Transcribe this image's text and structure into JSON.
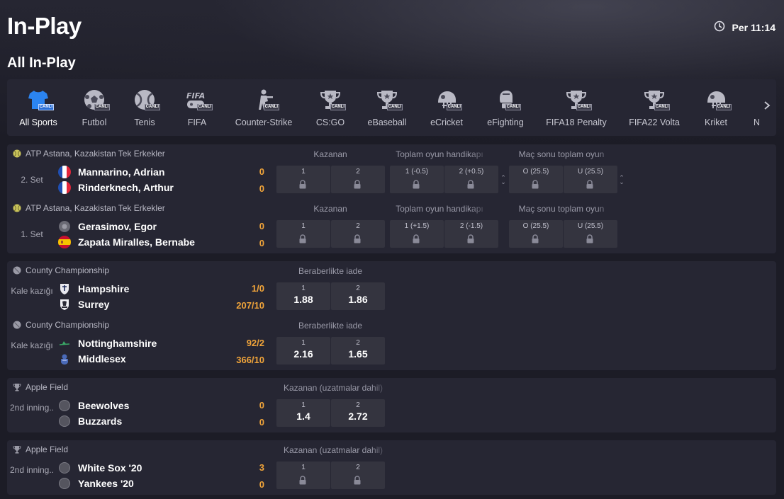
{
  "header": {
    "title": "In-Play",
    "time": "Per 11:14",
    "section_title": "All In-Play"
  },
  "sports_bar": {
    "badge": "CANLI",
    "items": [
      {
        "label": "All Sports",
        "icon": "shirt-icon",
        "active": true
      },
      {
        "label": "Futbol",
        "icon": "soccer-ball-icon",
        "active": false
      },
      {
        "label": "Tenis",
        "icon": "tennis-ball-icon",
        "active": false
      },
      {
        "label": "FIFA",
        "icon": "fifa-icon",
        "active": false
      },
      {
        "label": "Counter-Strike",
        "icon": "shooter-icon",
        "active": false
      },
      {
        "label": "CS:GO",
        "icon": "trophy-icon",
        "active": false
      },
      {
        "label": "eBaseball",
        "icon": "trophy-icon",
        "active": false
      },
      {
        "label": "eCricket",
        "icon": "helmet-icon",
        "active": false
      },
      {
        "label": "eFighting",
        "icon": "boxing-glove-icon",
        "active": false
      },
      {
        "label": "FIFA18 Penalty",
        "icon": "trophy-icon",
        "active": false
      },
      {
        "label": "FIFA22 Volta",
        "icon": "trophy-icon",
        "active": false
      },
      {
        "label": "Kriket",
        "icon": "helmet-icon",
        "active": false
      },
      {
        "label": "N",
        "icon": "",
        "active": false
      }
    ]
  },
  "colors": {
    "accent_blue": "#2b6fd6",
    "score_orange": "#f0a43a",
    "card_bg": "#262633",
    "odd_bg": "#34343f"
  },
  "events": [
    {
      "league": "ATP Astana, Kazakistan Tek Erkekler",
      "league_icon": "tennis-ball-icon",
      "status": "2. Set",
      "team1": {
        "name": "Mannarino, Adrian",
        "icon": "france-flag-icon",
        "score": "0"
      },
      "team2": {
        "name": "Rinderknech, Arthur",
        "icon": "france-flag-icon",
        "score": "0"
      },
      "markets": [
        {
          "label": "Kazanan",
          "odds": [
            {
              "label": "1",
              "value": ""
            },
            {
              "label": "2",
              "value": ""
            }
          ]
        },
        {
          "label": "Toplam oyun handikapı",
          "odds": [
            {
              "label": "1 (-0.5)",
              "value": ""
            },
            {
              "label": "2 (+0.5)",
              "value": ""
            }
          ]
        },
        {
          "label": "Maç sonu toplam oyun",
          "odds": [
            {
              "label": "O (25.5)",
              "value": ""
            },
            {
              "label": "U (25.5)",
              "value": ""
            }
          ]
        }
      ]
    },
    {
      "league": "ATP Astana, Kazakistan Tek Erkekler",
      "league_icon": "tennis-ball-icon",
      "status": "1. Set",
      "team1": {
        "name": "Gerasimov, Egor",
        "icon": "neutral-flag-icon",
        "score": "0"
      },
      "team2": {
        "name": "Zapata Miralles, Bernabe",
        "icon": "spain-flag-icon",
        "score": "0"
      },
      "markets": [
        {
          "label": "Kazanan",
          "odds": [
            {
              "label": "1",
              "value": ""
            },
            {
              "label": "2",
              "value": ""
            }
          ]
        },
        {
          "label": "Toplam oyun handikapı",
          "odds": [
            {
              "label": "1 (+1.5)",
              "value": ""
            },
            {
              "label": "2 (-1.5)",
              "value": ""
            }
          ]
        },
        {
          "label": "Maç sonu toplam oyun",
          "odds": [
            {
              "label": "O (25.5)",
              "value": ""
            },
            {
              "label": "U (25.5)",
              "value": ""
            }
          ]
        }
      ]
    },
    {
      "league": "County Championship",
      "league_icon": "cricket-ball-icon",
      "status": "Kale kazığı",
      "team1": {
        "name": "Hampshire",
        "icon": "hampshire-crest-icon",
        "score": "1/0"
      },
      "team2": {
        "name": "Surrey",
        "icon": "surrey-crest-icon",
        "score": "207/10"
      },
      "markets": [
        {
          "label": "Beraberlikte iade",
          "odds": [
            {
              "label": "1",
              "value": "1.88"
            },
            {
              "label": "2",
              "value": "1.86"
            }
          ]
        }
      ]
    },
    {
      "league": "County Championship",
      "league_icon": "cricket-ball-icon",
      "status": "Kale kazığı",
      "team1": {
        "name": "Nottinghamshire",
        "icon": "nottinghamshire-crest-icon",
        "score": "92/2"
      },
      "team2": {
        "name": "Middlesex",
        "icon": "middlesex-crest-icon",
        "score": "366/10"
      },
      "markets": [
        {
          "label": "Beraberlikte iade",
          "odds": [
            {
              "label": "1",
              "value": "2.16"
            },
            {
              "label": "2",
              "value": "1.65"
            }
          ]
        }
      ]
    },
    {
      "league": "Apple Field",
      "league_icon": "trophy-icon",
      "status": "2nd inning..",
      "team1": {
        "name": "Beewolves",
        "icon": "team-ball-icon",
        "score": "0"
      },
      "team2": {
        "name": "Buzzards",
        "icon": "team-ball-icon",
        "score": "0"
      },
      "markets": [
        {
          "label": "Kazanan (uzatmalar dahil)",
          "odds": [
            {
              "label": "1",
              "value": "1.4"
            },
            {
              "label": "2",
              "value": "2.72"
            }
          ]
        }
      ]
    },
    {
      "league": "Apple Field",
      "league_icon": "trophy-icon",
      "status": "2nd inning..",
      "team1": {
        "name": "White Sox '20",
        "icon": "team-ball-icon",
        "score": "3"
      },
      "team2": {
        "name": "Yankees '20",
        "icon": "team-ball-icon",
        "score": "0"
      },
      "markets": [
        {
          "label": "Kazanan (uzatmalar dahil)",
          "odds": [
            {
              "label": "1",
              "value": ""
            },
            {
              "label": "2",
              "value": ""
            }
          ]
        }
      ]
    }
  ]
}
